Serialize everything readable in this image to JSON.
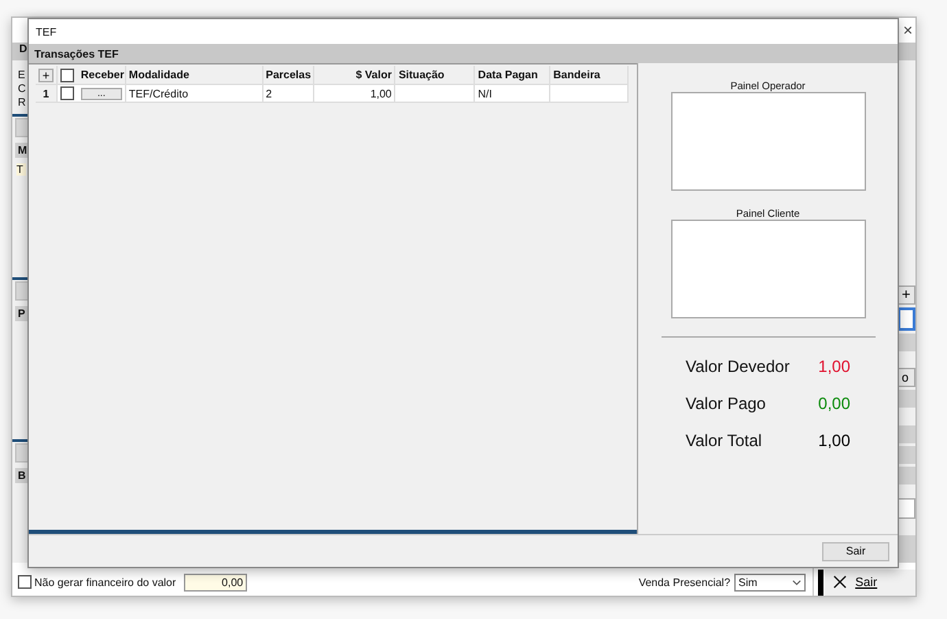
{
  "background_window": {
    "close_button": "×",
    "left_labels": [
      {
        "kind": "band",
        "text": "D"
      },
      {
        "kind": "field",
        "text": "E"
      },
      {
        "kind": "field",
        "text": "C"
      },
      {
        "kind": "field",
        "text": "R"
      },
      {
        "kind": "header",
        "text": "M"
      },
      {
        "kind": "cell",
        "text": "T"
      },
      {
        "kind": "header",
        "text": "P"
      },
      {
        "kind": "header",
        "text": "B"
      }
    ],
    "add_button": "+",
    "side_button": "o",
    "no_financial": {
      "label": "Não gerar financeiro do valor",
      "checked": false
    },
    "value_field": "0,00",
    "venda_presencial": {
      "label": "Venda Presencial?",
      "value": "Sim"
    },
    "exit_button": "Sair"
  },
  "dialog": {
    "title": "TEF",
    "section_title": "Transações TEF",
    "grid": {
      "add_button": "+",
      "select_all_checked": false,
      "columns": [
        {
          "label": "Receber",
          "kind": "button"
        },
        {
          "label": "Modalidade",
          "kind": "text"
        },
        {
          "label": "Parcelas",
          "kind": "text"
        },
        {
          "label": "$ Valor",
          "kind": "number"
        },
        {
          "label": "Situação",
          "kind": "text"
        },
        {
          "label": "Data Pagan",
          "kind": "text"
        },
        {
          "label": "Bandeira",
          "kind": "text"
        }
      ],
      "rows": [
        {
          "number": "1",
          "checked": false,
          "cells": [
            "...",
            "TEF/Crédito",
            "2",
            "1,00",
            "",
            "N/I",
            ""
          ]
        }
      ]
    },
    "painel_operador": "Painel Operador",
    "painel_cliente": "Painel Cliente",
    "totals": [
      {
        "label": "Valor Devedor",
        "value": "1,00",
        "color": "#e0102d"
      },
      {
        "label": "Valor Pago",
        "value": "0,00",
        "color": "#0a8a0a"
      },
      {
        "label": "Valor Total",
        "value": "1,00",
        "color": "#000000"
      }
    ],
    "exit_button": "Sair"
  }
}
